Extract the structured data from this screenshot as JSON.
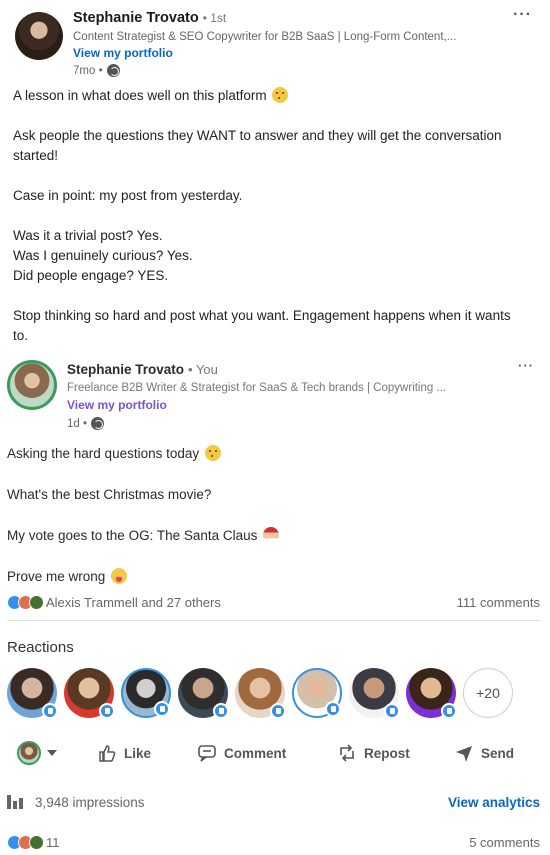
{
  "outer_post": {
    "author_name": "Stephanie Trovato",
    "connection_degree": "• 1st",
    "headline": "Content Strategist & SEO Copywriter for B2B SaaS | Long-Form Content,...",
    "portfolio_link": "View my portfolio",
    "age": "7mo •",
    "more_menu": "···",
    "body": [
      "A lesson in what does well on this platform",
      "Ask people the questions they WANT to answer and they will get the conversation started!",
      "Case in point: my post from yesterday.",
      "Was it a trivial post? Yes.",
      "Was I genuinely curious? Yes.",
      "Did people engage? YES.",
      "Stop thinking so hard and post what you want. Engagement happens when it wants to."
    ]
  },
  "inner_post": {
    "author_name": "Stephanie Trovato",
    "you_label": "• You",
    "headline": "Freelance B2B Writer & Strategist for SaaS & Tech brands | Copywriting ...",
    "portfolio_link": "View my portfolio",
    "age": "1d •",
    "more_menu": "···",
    "body": [
      "Asking the hard questions today",
      "What's the best Christmas movie?",
      "My vote goes to the OG: The Santa Claus",
      "Prove me wrong"
    ],
    "reactions_summary": "Alexis Trammell and 27 others",
    "comments_count": "111 comments",
    "reactions_title": "Reactions",
    "more_reactors": "+20",
    "actions": {
      "like": "Like",
      "comment": "Comment",
      "repost": "Repost",
      "send": "Send"
    },
    "impressions": "3,948 impressions",
    "view_analytics": "View analytics"
  },
  "outer_social": {
    "reactions_count": "11",
    "comments_count": "5 comments"
  },
  "colors": {
    "link_blue": "#0a66c2",
    "portfolio_purple": "#7b55c8",
    "like_blue": "#378fe9",
    "avatar_ring_green": "#3a9b5a"
  }
}
